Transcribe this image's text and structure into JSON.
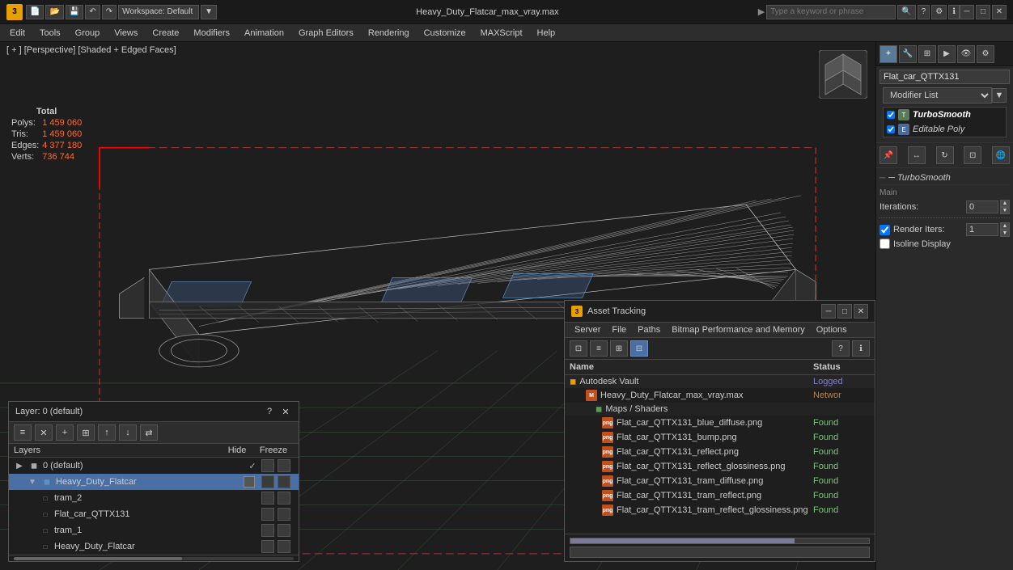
{
  "titlebar": {
    "title": "Heavy_Duty_Flatcar_max_vray.max",
    "search_placeholder": "Type a keyword or phrase",
    "workspace_label": "Workspace: Default",
    "logo": "3",
    "min_btn": "─",
    "max_btn": "□",
    "close_btn": "✕"
  },
  "menubar": {
    "items": [
      "Edit",
      "Tools",
      "Group",
      "Views",
      "Create",
      "Modifiers",
      "Animation",
      "Graph Editors",
      "Rendering",
      "Customize",
      "MAXScript",
      "Help"
    ]
  },
  "viewport": {
    "label": "[ + ] [Perspective] [Shaded + Edged Faces]",
    "stats": {
      "total_label": "Total",
      "polys_label": "Polys:",
      "polys_val": "1 459 060",
      "tris_label": "Tris:",
      "tris_val": "1 459 060",
      "edges_label": "Edges:",
      "edges_val": "4 377 180",
      "verts_label": "Verts:",
      "verts_val": "736 744"
    }
  },
  "right_panel": {
    "object_name": "Flat_car_QTTX131",
    "modifier_list_label": "Modifier List",
    "modifiers": [
      {
        "name": "TurboSmooth",
        "type": "green"
      },
      {
        "name": "Editable Poly",
        "type": "blue"
      }
    ],
    "turbosmooth": {
      "section_label": "─ TurboSmooth",
      "main_label": "Main",
      "iterations_label": "Iterations:",
      "iterations_val": "0",
      "render_iters_label": "Render Iters:",
      "render_iters_val": "1",
      "isoline_label": "Isoline Display"
    }
  },
  "layer_panel": {
    "title": "Layer: 0 (default)",
    "close_btn": "✕",
    "question_btn": "?",
    "columns": {
      "name": "Layers",
      "hide": "Hide",
      "freeze": "Freeze"
    },
    "layers": [
      {
        "name": "0 (default)",
        "indent": 0,
        "checked": true,
        "selected": false
      },
      {
        "name": "Heavy_Duty_Flatcar",
        "indent": 1,
        "checked": false,
        "selected": true
      },
      {
        "name": "tram_2",
        "indent": 2,
        "checked": false,
        "selected": false
      },
      {
        "name": "Flat_car_QTTX131",
        "indent": 2,
        "checked": false,
        "selected": false
      },
      {
        "name": "tram_1",
        "indent": 2,
        "checked": false,
        "selected": false
      },
      {
        "name": "Heavy_Duty_Flatcar",
        "indent": 2,
        "checked": false,
        "selected": false
      }
    ]
  },
  "asset_tracking": {
    "title": "Asset Tracking",
    "menu_items": [
      "Server",
      "File",
      "Paths",
      "Bitmap Performance and Memory",
      "Options"
    ],
    "table_header": {
      "name_col": "Name",
      "status_col": "Status"
    },
    "groups": [
      {
        "name": "Autodesk Vault",
        "status": "Logged",
        "children": [
          {
            "name": "Heavy_Duty_Flatcar_max_vray.max",
            "status": "Networ",
            "icon_type": "max",
            "children": [
              {
                "name": "Maps / Shaders",
                "children": [
                  {
                    "name": "Flat_car_QTTX131_blue_diffuse.png",
                    "status": "Found",
                    "icon_type": "png"
                  },
                  {
                    "name": "Flat_car_QTTX131_bump.png",
                    "status": "Found",
                    "icon_type": "png"
                  },
                  {
                    "name": "Flat_car_QTTX131_reflect.png",
                    "status": "Found",
                    "icon_type": "png"
                  },
                  {
                    "name": "Flat_car_QTTX131_reflect_glossiness.png",
                    "status": "Found",
                    "icon_type": "png"
                  },
                  {
                    "name": "Flat_car_QTTX131_tram_diffuse.png",
                    "status": "Found",
                    "icon_type": "png"
                  },
                  {
                    "name": "Flat_car_QTTX131_tram_reflect.png",
                    "status": "Found",
                    "icon_type": "png"
                  },
                  {
                    "name": "Flat_car_QTTX131_tram_reflect_glossiness.png",
                    "status": "Found",
                    "icon_type": "png"
                  }
                ]
              }
            ]
          }
        ]
      }
    ]
  }
}
